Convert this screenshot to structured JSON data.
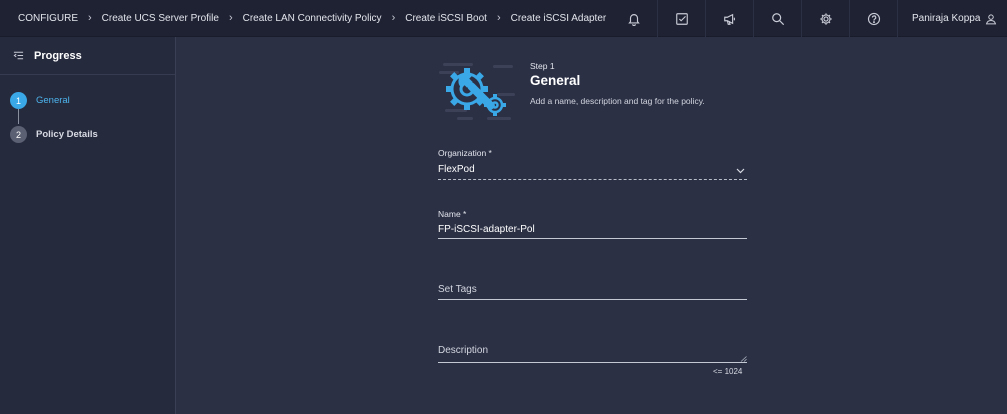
{
  "breadcrumb": [
    {
      "label": "CONFIGURE"
    },
    {
      "label": "Create UCS Server Profile"
    },
    {
      "label": "Create LAN Connectivity Policy"
    },
    {
      "label": "Create iSCSI Boot"
    },
    {
      "label": "Create iSCSI Adapter"
    }
  ],
  "topbar": {
    "icons": [
      "bell-icon",
      "checklist-icon",
      "megaphone-icon",
      "search-icon",
      "gear-icon",
      "help-icon"
    ],
    "user_name": "Paniraja Koppa"
  },
  "sidebar": {
    "title": "Progress",
    "steps": [
      {
        "number": "1",
        "label": "General",
        "state": "active"
      },
      {
        "number": "2",
        "label": "Policy Details",
        "state": "inactive"
      }
    ]
  },
  "main": {
    "step_small": "Step 1",
    "step_title": "General",
    "step_description": "Add a name, description and tag for the policy.",
    "organization": {
      "label": "Organization *",
      "value": "FlexPod"
    },
    "name": {
      "label": "Name *",
      "value": "FP-iSCSI-adapter-Pol"
    },
    "tags": {
      "placeholder": "Set Tags"
    },
    "description": {
      "placeholder": "Description",
      "limit": "<= 1024"
    }
  },
  "colors": {
    "accent": "#3aa7e6",
    "background": "#2b3045",
    "topbar": "#1f2233",
    "sidebar": "#262a3d"
  }
}
